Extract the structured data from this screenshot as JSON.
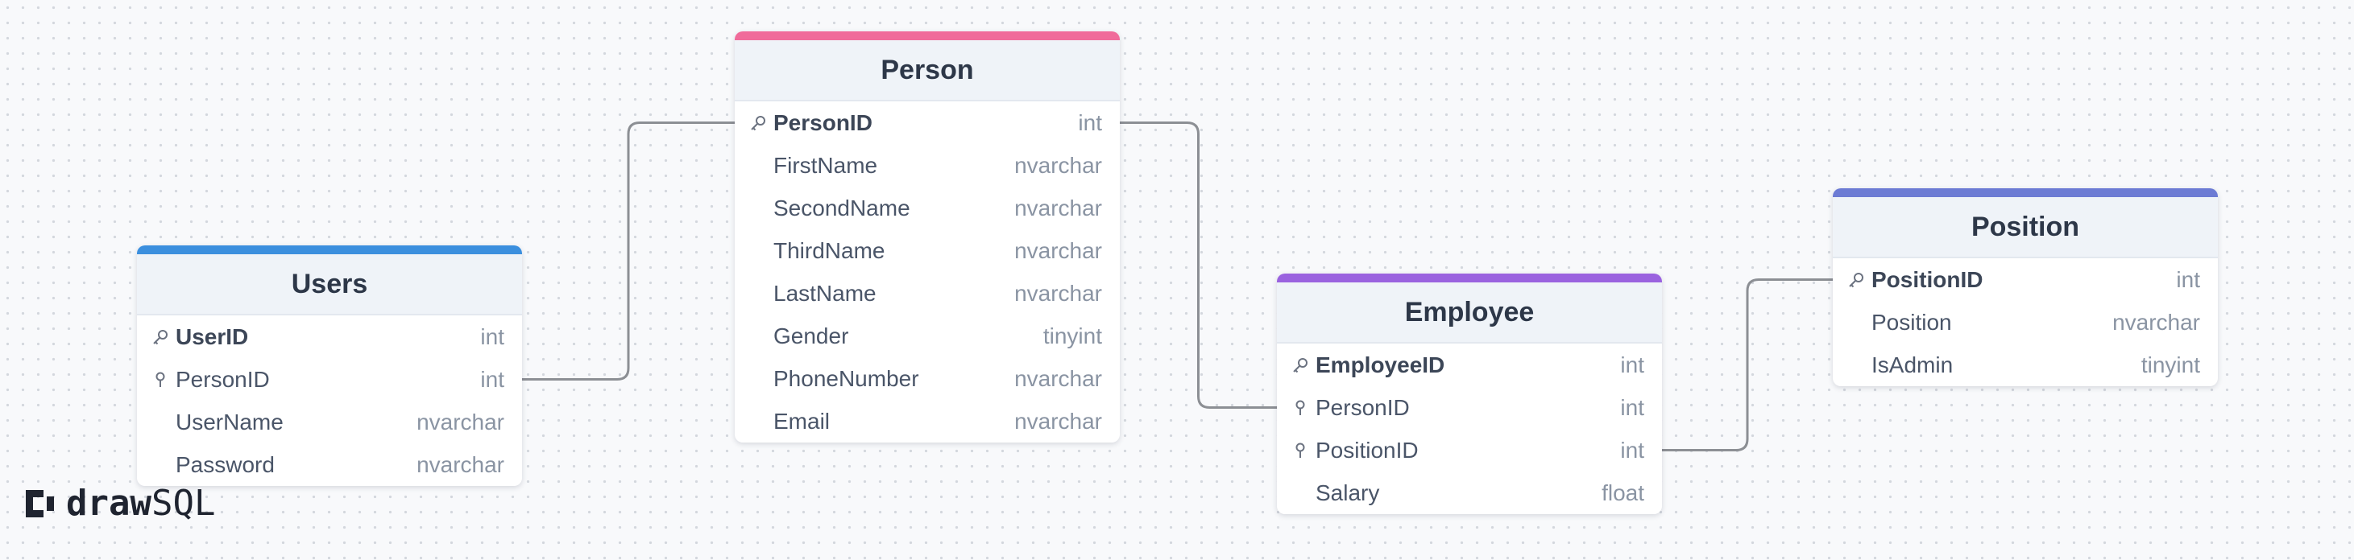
{
  "diagram": {
    "tables": [
      {
        "id": "users",
        "name": "Users",
        "color": "#3b8fde",
        "columns": [
          {
            "name": "UserID",
            "type": "int",
            "key": "pk"
          },
          {
            "name": "PersonID",
            "type": "int",
            "key": "fk"
          },
          {
            "name": "UserName",
            "type": "nvarchar",
            "key": "none"
          },
          {
            "name": "Password",
            "type": "nvarchar",
            "key": "none"
          }
        ]
      },
      {
        "id": "person",
        "name": "Person",
        "color": "#f06b9a",
        "columns": [
          {
            "name": "PersonID",
            "type": "int",
            "key": "pk"
          },
          {
            "name": "FirstName",
            "type": "nvarchar",
            "key": "none"
          },
          {
            "name": "SecondName",
            "type": "nvarchar",
            "key": "none"
          },
          {
            "name": "ThirdName",
            "type": "nvarchar",
            "key": "none"
          },
          {
            "name": "LastName",
            "type": "nvarchar",
            "key": "none"
          },
          {
            "name": "Gender",
            "type": "tinyint",
            "key": "none"
          },
          {
            "name": "PhoneNumber",
            "type": "nvarchar",
            "key": "none"
          },
          {
            "name": "Email",
            "type": "nvarchar",
            "key": "none"
          }
        ]
      },
      {
        "id": "employee",
        "name": "Employee",
        "color": "#9a62df",
        "columns": [
          {
            "name": "EmployeeID",
            "type": "int",
            "key": "pk"
          },
          {
            "name": "PersonID",
            "type": "int",
            "key": "fk"
          },
          {
            "name": "PositionID",
            "type": "int",
            "key": "fk"
          },
          {
            "name": "Salary",
            "type": "float",
            "key": "none"
          }
        ]
      },
      {
        "id": "position",
        "name": "Position",
        "color": "#6c7bd4",
        "columns": [
          {
            "name": "PositionID",
            "type": "int",
            "key": "pk"
          },
          {
            "name": "Position",
            "type": "nvarchar",
            "key": "none"
          },
          {
            "name": "IsAdmin",
            "type": "tinyint",
            "key": "none"
          }
        ]
      }
    ],
    "relations": [
      {
        "from": "users.PersonID",
        "to": "person.PersonID"
      },
      {
        "from": "person.PersonID",
        "to": "employee.PersonID"
      },
      {
        "from": "employee.PositionID",
        "to": "position.PositionID"
      }
    ]
  },
  "branding": {
    "logo_bold": "draw",
    "logo_light": "SQL",
    "icon": "drawsql-logo-icon"
  },
  "colors": {
    "line": "#8c8f94",
    "text": "#4a5568",
    "type": "#8a94a3"
  }
}
